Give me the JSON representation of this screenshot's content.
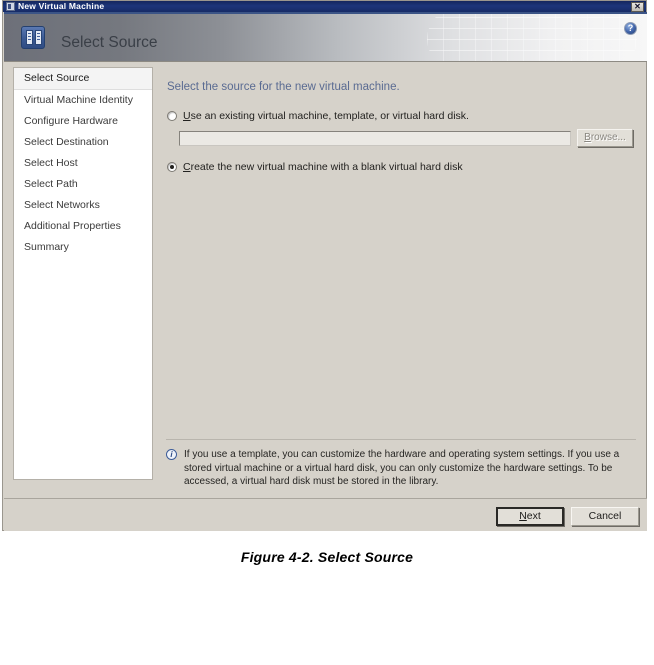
{
  "window": {
    "title": "New Virtual Machine",
    "title_icon": "vm-window-icon",
    "close_label": "✕"
  },
  "header": {
    "title": "Select Source",
    "icon": "server-rack-icon",
    "help_label": "?",
    "help_icon": "help-question-icon"
  },
  "sidebar": {
    "items": [
      {
        "label": "Select Source",
        "selected": true
      },
      {
        "label": "Virtual Machine Identity",
        "selected": false
      },
      {
        "label": "Configure Hardware",
        "selected": false
      },
      {
        "label": "Select Destination",
        "selected": false
      },
      {
        "label": "Select Host",
        "selected": false
      },
      {
        "label": "Select Path",
        "selected": false
      },
      {
        "label": "Select Networks",
        "selected": false
      },
      {
        "label": "Additional Properties",
        "selected": false
      },
      {
        "label": "Summary",
        "selected": false
      }
    ]
  },
  "main": {
    "heading": "Select the source for the new virtual machine.",
    "options": [
      {
        "id": "use-existing",
        "accelerator": "U",
        "label_rest": "se an existing virtual machine, template, or virtual hard disk.",
        "checked": false
      },
      {
        "id": "create-blank",
        "accelerator": "C",
        "label_rest": "reate the new virtual machine with a blank virtual hard disk",
        "checked": true
      }
    ],
    "path_field": {
      "value": "",
      "placeholder": "",
      "enabled": false
    },
    "browse_button": {
      "accelerator": "B",
      "label_rest": "rowse...",
      "enabled": false
    },
    "note": {
      "icon": "info-circle-icon",
      "text": "If you use a template, you can customize the hardware and operating system settings. If you use a stored virtual machine or a virtual hard disk, you can only customize the hardware settings. To be accessed, a virtual hard disk must be stored in the library."
    }
  },
  "footer": {
    "next": {
      "accelerator": "N",
      "label_rest": "ext"
    },
    "cancel": {
      "label": "Cancel"
    }
  },
  "caption": {
    "text": "Figure 4-2.  Select Source"
  }
}
